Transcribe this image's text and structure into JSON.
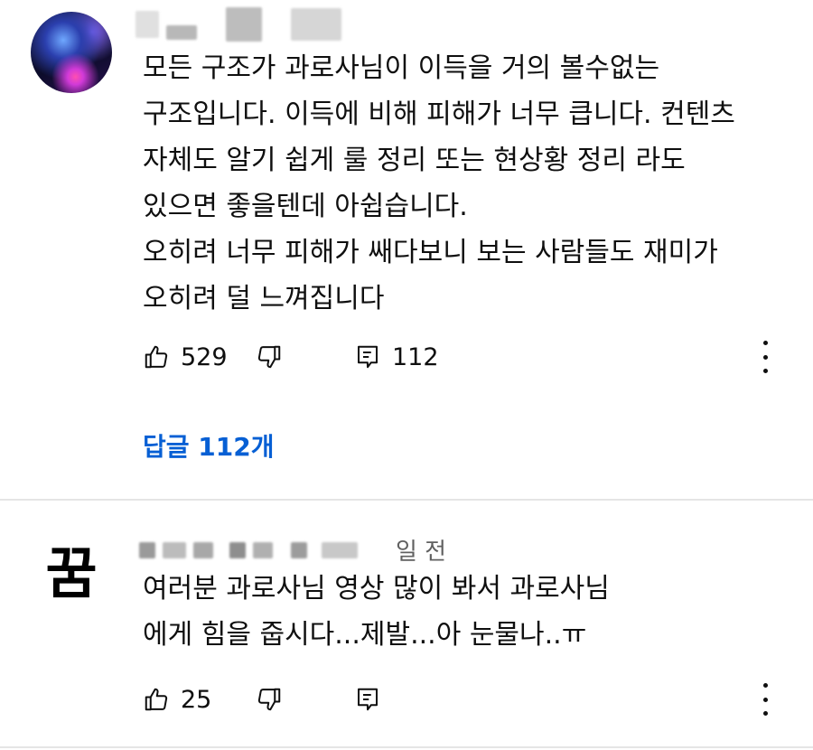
{
  "comments": [
    {
      "author_blurred": true,
      "lines": [
        "모든 구조가 과로사님이 이득을 거의 볼수없는",
        "구조입니다. 이득에 비해 피해가 너무 큽니다. 컨텐츠",
        "자체도 알기 쉽게 룰 정리 또는 현상황 정리 라도",
        "있으면 좋을텐데 아쉽습니다.",
        "오히려 너무 피해가 쌔다보니 보는 사람들도 재미가",
        "오히려 덜 느껴집니다"
      ],
      "likes": "529",
      "reply_count": "112",
      "replies_link": "답글 112개"
    },
    {
      "avatar_text": "꿈",
      "time_ago": "일 전",
      "lines": [
        "여러분 과로사님 영상 많이 봐서 과로사님",
        "에게 힘을 줍시다...제발...아 눈물나..ㅠ"
      ],
      "likes": "25"
    }
  ],
  "icons": [
    "thumbs-up-icon",
    "thumbs-down-icon",
    "reply-icon",
    "more-vert-icon"
  ],
  "colors": {
    "link": "#065fd4",
    "divider": "#e5e5e5",
    "text": "#0f0f0f",
    "secondary": "#606060"
  }
}
